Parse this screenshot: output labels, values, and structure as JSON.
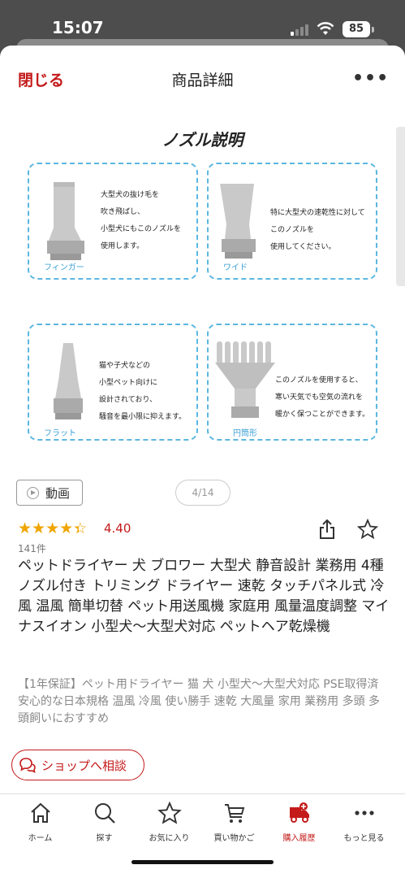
{
  "status_bar": {
    "time": "15:07",
    "battery": "85"
  },
  "header": {
    "close_label": "閉じる",
    "title": "商品詳細",
    "more_label": "•••"
  },
  "image": {
    "title": "ノズル説明",
    "nozzles": [
      {
        "name": "フィンガー",
        "desc": "大型犬の抜け毛を\n吹き飛ばし、\n小型犬にもこのノズルを\n使用します。"
      },
      {
        "name": "ワイド",
        "desc": "特に大型犬の速乾性に対して\nこのノズルを\n使用してください。"
      },
      {
        "name": "フラット",
        "desc": "猫や子犬などの\n小型ペット向けに\n設計されており、\n騒音を最小限に抑えます。"
      },
      {
        "name": "円筒形",
        "desc": "このノズルを使用すると、\n寒い天気でも空気の流れを\n暖かく保つことができます。"
      }
    ]
  },
  "media": {
    "video_label": "動画",
    "pager": "4/14"
  },
  "rating": {
    "value": "4.40",
    "stars": 4.4,
    "count": "141件"
  },
  "product": {
    "title": "ペットドライヤー 犬 ブロワー 大型犬 静音設計 業務用 4種ノズル付き トリミング ドライヤー 速乾 タッチパネル式 冷風 温風 簡単切替 ペット用送風機 家庭用 風量温度調整 マイナスイオン 小型犬～大型犬対応 ペットヘア乾燥機",
    "description": "【1年保証】ペット用ドライヤー 猫 犬 小型犬～大型犬対応 PSE取得済 安心的な日本規格 温風 冷風 使い勝手 速乾 大風量 家用 業務用 多頭 多頭飼いにおすすめ"
  },
  "shop_button": {
    "label": "ショップへ相談"
  },
  "tabbar": {
    "items": [
      {
        "label": "ホーム",
        "icon": "home-icon"
      },
      {
        "label": "探す",
        "icon": "search-icon"
      },
      {
        "label": "お気に入り",
        "icon": "star-icon"
      },
      {
        "label": "買い物かご",
        "icon": "cart-icon"
      },
      {
        "label": "購入履歴",
        "icon": "truck-icon",
        "active": true
      },
      {
        "label": "もっと見る",
        "icon": "more-icon"
      }
    ]
  },
  "colors": {
    "accent": "#c41a1a",
    "star": "#f0a500",
    "nozzle_border": "#5bb7e0"
  }
}
